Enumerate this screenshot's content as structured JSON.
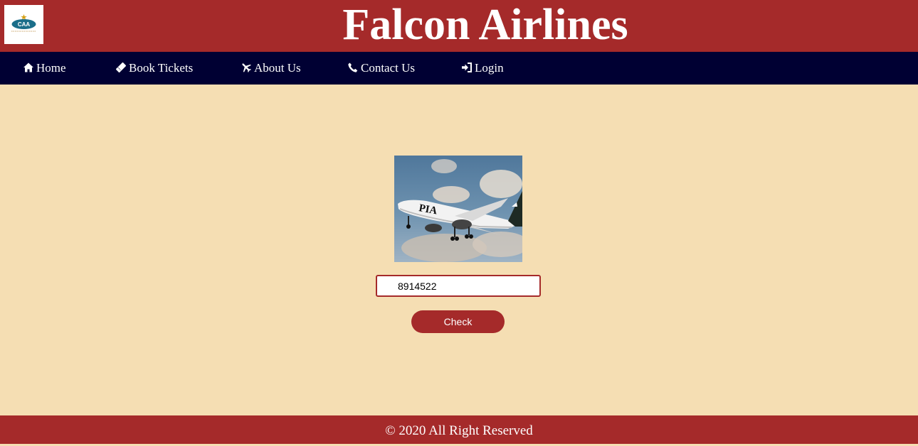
{
  "header": {
    "title": "Falcon Airlines",
    "logo_text": "CAA",
    "background_color": "#a52a2a"
  },
  "nav": {
    "background_color": "#000033",
    "items": [
      {
        "label": "Home",
        "icon": "home-icon"
      },
      {
        "label": "Book Tickets",
        "icon": "ticket-icon"
      },
      {
        "label": "About Us",
        "icon": "plane-icon"
      },
      {
        "label": "Contact Us",
        "icon": "phone-icon"
      },
      {
        "label": "Login",
        "icon": "sign-in-icon"
      }
    ]
  },
  "main": {
    "background_color": "#f5deb3",
    "image_text": "PIA",
    "pnr_value": "8914522",
    "check_label": "Check"
  },
  "footer": {
    "text": "© 2020 All Right Reserved"
  }
}
